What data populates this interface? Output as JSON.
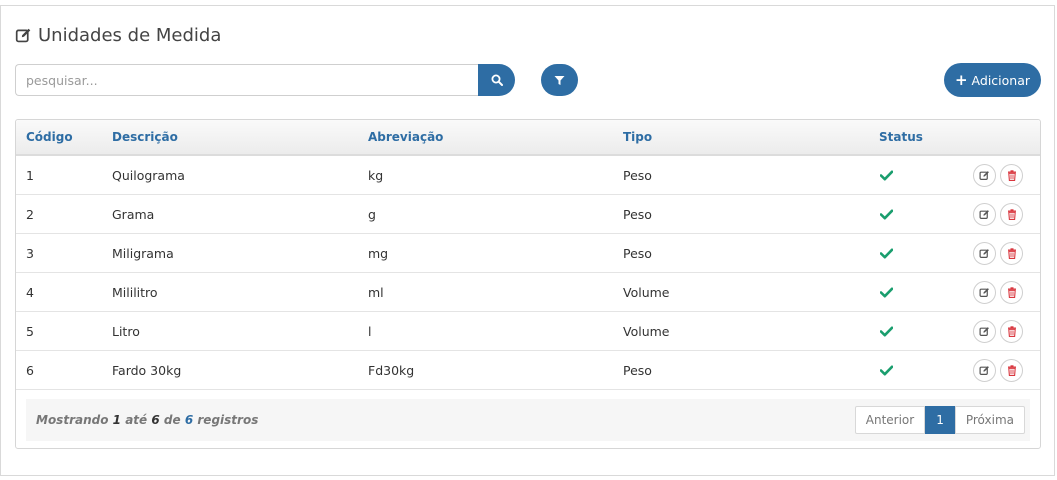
{
  "header": {
    "title": "Unidades de Medida",
    "title_icon": "edit-icon"
  },
  "toolbar": {
    "search_placeholder": "pesquisar...",
    "search_value": "",
    "search_icon": "search-icon",
    "filter_icon": "filter-icon",
    "add_label": "Adicionar",
    "add_icon": "plus-icon"
  },
  "table": {
    "columns": [
      "Código",
      "Descrição",
      "Abreviação",
      "Tipo",
      "Status"
    ],
    "rows": [
      {
        "codigo": "1",
        "descricao": "Quilograma",
        "abreviacao": "kg",
        "tipo": "Peso",
        "status": "active"
      },
      {
        "codigo": "2",
        "descricao": "Grama",
        "abreviacao": "g",
        "tipo": "Peso",
        "status": "active"
      },
      {
        "codigo": "3",
        "descricao": "Miligrama",
        "abreviacao": "mg",
        "tipo": "Peso",
        "status": "active"
      },
      {
        "codigo": "4",
        "descricao": "Mililitro",
        "abreviacao": "ml",
        "tipo": "Volume",
        "status": "active"
      },
      {
        "codigo": "5",
        "descricao": "Litro",
        "abreviacao": "l",
        "tipo": "Volume",
        "status": "active"
      },
      {
        "codigo": "6",
        "descricao": "Fardo 30kg",
        "abreviacao": "Fd30kg",
        "tipo": "Peso",
        "status": "active"
      }
    ]
  },
  "footer": {
    "prefix": "Mostrando",
    "from": "1",
    "to_word": "até",
    "to": "6",
    "of_word": "de",
    "total": "6",
    "suffix": "registros"
  },
  "pagination": {
    "prev_label": "Anterior",
    "current_page": "1",
    "next_label": "Próxima"
  },
  "colors": {
    "primary": "#2e6da4",
    "status_ok": "#1a9e6e",
    "delete": "#d9363e"
  }
}
